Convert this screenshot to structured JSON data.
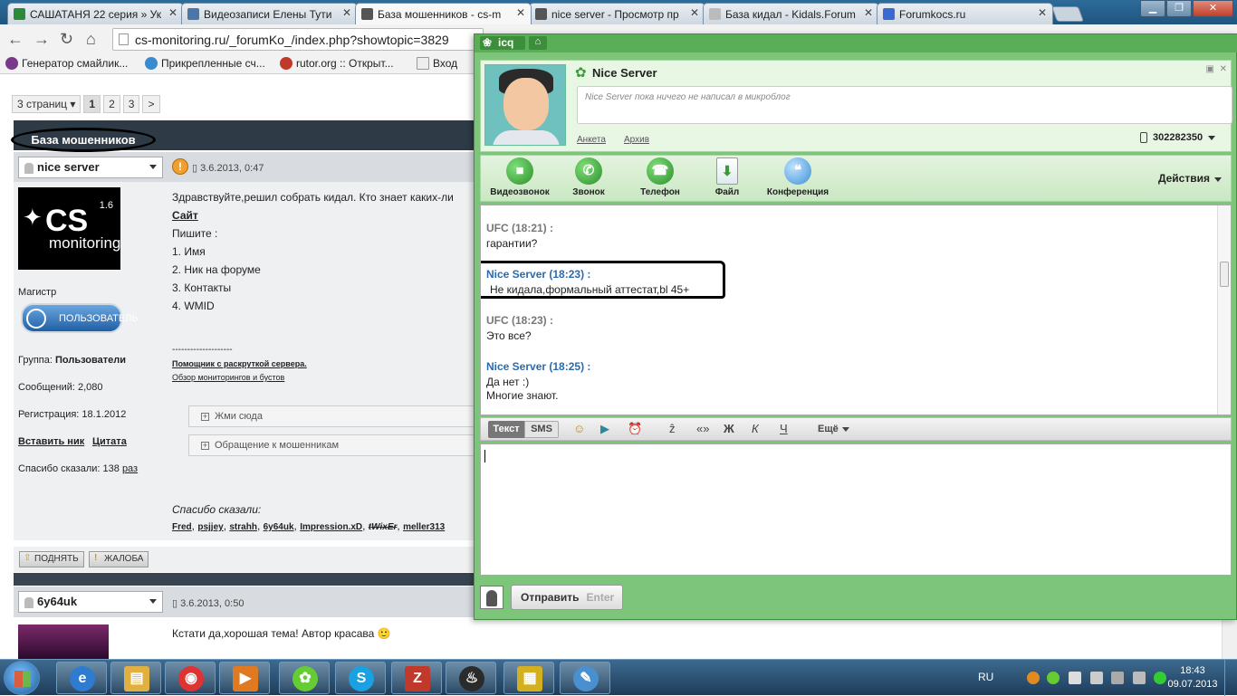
{
  "browser": {
    "tabs": [
      {
        "title": "САШАТАНЯ 22 серия » Ук",
        "color": "#2a8a3a",
        "active": false
      },
      {
        "title": "Видеозаписи Елены Тути",
        "color": "#4a76a8",
        "active": false
      },
      {
        "title": "База мошенников - cs-m",
        "color": "#555555",
        "active": true
      },
      {
        "title": "nice server - Просмотр пр",
        "color": "#555555",
        "active": false
      },
      {
        "title": "База кидал - Kidals.Forum",
        "color": "#bbbbbb",
        "active": false
      },
      {
        "title": "Forumkocs.ru",
        "color": "#3a6ad0",
        "active": false
      }
    ],
    "window_controls": {
      "minimize": "▁",
      "maximize": "❐",
      "close": "✕"
    },
    "nav": {
      "back": "←",
      "forward": "→",
      "reload": "↻",
      "home": "⌂"
    },
    "url": "cs-monitoring.ru/_forumKo_/index.php?showtopic=3829",
    "bookmarks": [
      {
        "label": "Генератор смайлик...",
        "color": "#7a3a8a"
      },
      {
        "label": "Прикрепленные сч...",
        "color": "#3a8ad0"
      },
      {
        "label": "rutor.org :: Открыт...",
        "color": "#c0392b"
      },
      {
        "label": "Вход",
        "color": "#eeeeee"
      }
    ]
  },
  "forum": {
    "pager": {
      "summary": "3 страниц ▾",
      "pages": [
        "1",
        "2",
        "3"
      ],
      "next": ">"
    },
    "topic_title": "База мошенников",
    "post1": {
      "author": "nice server",
      "date": "3.6.2013, 0:47",
      "avatar": {
        "main": "CS",
        "version": "1.6",
        "sub": "monitoring"
      },
      "rank": "Магистр",
      "badge": "ПОЛЬЗОВАТЕЛЬ",
      "group_label": "Группа:",
      "group": "Пользователи",
      "messages": "Сообщений: 2,080",
      "registered": "Регистрация: 18.1.2012",
      "insert_nick": "Вставить ник",
      "quote": "Цитата",
      "thanks_said": "Спасибо сказали: 138",
      "thanks_unit": "раз",
      "body_lines": [
        "Здравствуйте,решил собрать кидал. Кто знает каких-ли",
        "Сайт",
        "Пишите :",
        "1. Имя",
        "2. Ник на форуме",
        "3. Контакты",
        "4. WMID"
      ],
      "signature_sep": "--------------------",
      "signature_link1": "Помощник с раскруткой сервера.",
      "signature_link2": "Обзор мониторингов и бустов",
      "spoilers": [
        "Жми сюда",
        "Обращение к мошенникам"
      ],
      "thanks_title": "Спасибо сказали:",
      "thanks_users": [
        "Fred",
        "psjjey",
        "strahh",
        "6y64uk",
        "Impression.xD",
        "tWixEr",
        "meller313"
      ],
      "btn_up": "ПОДНЯТЬ",
      "btn_report": "ЖАЛОБА"
    },
    "post2": {
      "author": "6y64uk",
      "date": "3.6.2013, 0:50",
      "body": "Кстати да,хорошая тема! Автор красава 🙂"
    }
  },
  "icq": {
    "logo": "icq",
    "contact_name": "Nice Server",
    "microblog": "Nice Server пока ничего не написал в микроблог",
    "profile_link": "Анкета",
    "archive_link": "Архив",
    "phone": "302282350",
    "actions": [
      "Видеозвонок",
      "Звонок",
      "Телефон",
      "Файл",
      "Конференция"
    ],
    "actions_more": "Действия",
    "messages": [
      {
        "who": "UFC (18:21) :",
        "me": false,
        "lines": [
          "гарантии?"
        ]
      },
      {
        "who": "Nice Server (18:23) :",
        "me": true,
        "lines": [
          "Не кидала,формальный аттестат,bl 45+"
        ]
      },
      {
        "who": "UFC (18:23) :",
        "me": false,
        "lines": [
          "Это все?"
        ]
      },
      {
        "who": "Nice Server (18:25) :",
        "me": true,
        "lines": [
          "Да нет :)",
          "Многие знают."
        ]
      }
    ],
    "format": {
      "tab_text": "Текст",
      "tab_sms": "SMS",
      "tools": [
        "☺",
        "▶",
        "⏰",
        "ẑ",
        "«»",
        "Ж",
        "К",
        "Ч"
      ],
      "more": "Ещё"
    },
    "send_label": "Отправить",
    "send_hint": "Enter"
  },
  "taskbar": {
    "lang": "RU",
    "time": "18:43",
    "date": "09.07.2013",
    "apps": [
      {
        "name": "ie",
        "color": "#2e7bd0",
        "glyph": "e"
      },
      {
        "name": "explorer",
        "color": "#e0b040",
        "glyph": "▤"
      },
      {
        "name": "chrome",
        "color": "#d33",
        "glyph": "◉"
      },
      {
        "name": "media",
        "color": "#e07a20",
        "glyph": "▶"
      },
      {
        "name": "icq",
        "color": "#6c3",
        "glyph": "✿"
      },
      {
        "name": "skype",
        "color": "#1ba1e2",
        "glyph": "S"
      },
      {
        "name": "filezilla",
        "color": "#c0392b",
        "glyph": "Z"
      },
      {
        "name": "steam",
        "color": "#2b2b2b",
        "glyph": "♨"
      },
      {
        "name": "tool",
        "color": "#d4b020",
        "glyph": "▦"
      },
      {
        "name": "paint",
        "color": "#4a90d0",
        "glyph": "✎"
      }
    ]
  }
}
